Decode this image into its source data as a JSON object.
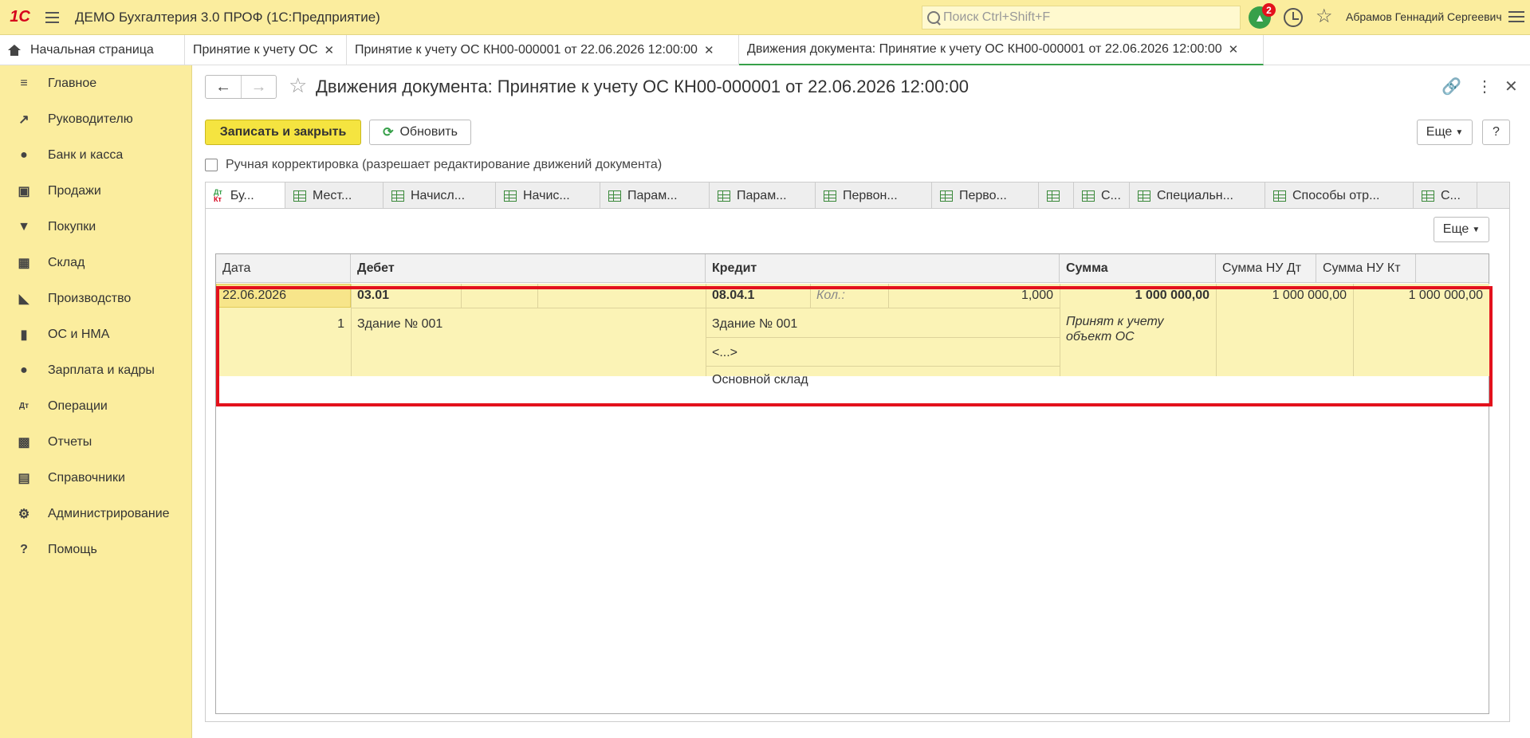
{
  "app": {
    "logo": "1С",
    "title": "ДЕМО Бухгалтерия 3.0 ПРОФ  (1С:Предприятие)"
  },
  "search": {
    "placeholder": "Поиск Ctrl+Shift+F"
  },
  "notifications": {
    "count": "2"
  },
  "user": {
    "name": "Абрамов Геннадий Сергеевич"
  },
  "open_tabs": [
    {
      "label": "Начальная страница"
    },
    {
      "label": "Принятие к учету ОС"
    },
    {
      "label": "Принятие к учету ОС КН00-000001 от 22.06.2026 12:00:00"
    },
    {
      "label": "Движения документа: Принятие к учету ОС КН00-000001 от 22.06.2026 12:00:00"
    }
  ],
  "sidebar": {
    "items": [
      {
        "label": "Главное",
        "icon": "menu-icon"
      },
      {
        "label": "Руководителю",
        "icon": "chart-icon"
      },
      {
        "label": "Банк и касса",
        "icon": "coin-icon"
      },
      {
        "label": "Продажи",
        "icon": "bag-icon"
      },
      {
        "label": "Покупки",
        "icon": "cart-icon"
      },
      {
        "label": "Склад",
        "icon": "warehouse-icon"
      },
      {
        "label": "Производство",
        "icon": "factory-icon"
      },
      {
        "label": "ОС и НМА",
        "icon": "truck-icon"
      },
      {
        "label": "Зарплата и кадры",
        "icon": "person-icon"
      },
      {
        "label": "Операции",
        "icon": "dtkt-icon"
      },
      {
        "label": "Отчеты",
        "icon": "bars-icon"
      },
      {
        "label": "Справочники",
        "icon": "books-icon"
      },
      {
        "label": "Администрирование",
        "icon": "gear-icon"
      },
      {
        "label": "Помощь",
        "icon": "help-icon"
      }
    ]
  },
  "document": {
    "title": "Движения документа: Принятие к учету ОС КН00-000001 от 22.06.2026 12:00:00",
    "save_close": "Записать и закрыть",
    "refresh": "Обновить",
    "more": "Еще",
    "help": "?",
    "manual_label": "Ручная корректировка (разрешает редактирование движений документа)"
  },
  "register_tabs": [
    {
      "label": "Бу..."
    },
    {
      "label": "Мест..."
    },
    {
      "label": "Начисл..."
    },
    {
      "label": "Начис..."
    },
    {
      "label": "Парам..."
    },
    {
      "label": "Парам..."
    },
    {
      "label": "Первон..."
    },
    {
      "label": "Перво..."
    },
    {
      "label": ""
    },
    {
      "label": "С..."
    },
    {
      "label": "Специальн..."
    },
    {
      "label": "Способы отр..."
    },
    {
      "label": "С..."
    }
  ],
  "table": {
    "more": "Еще",
    "headers": [
      "Дата",
      "Дебет",
      "Кредит",
      "Сумма",
      "Сумма НУ Дт",
      "Сумма НУ Кт"
    ],
    "row": {
      "date": "22.06.2026",
      "line": "1",
      "debit_account": "03.01",
      "debit_sub1": "Здание № 001",
      "credit_account": "08.04.1",
      "qty_label": "Кол.:",
      "qty": "1,000",
      "credit_sub1": "Здание № 001",
      "credit_sub2": "<...>",
      "credit_sub3": "Основной склад",
      "sum": "1 000 000,00",
      "content": "Принят к учету объект ОС",
      "sum_nu_dt": "1 000 000,00",
      "sum_nu_kt": "1 000 000,00"
    }
  }
}
